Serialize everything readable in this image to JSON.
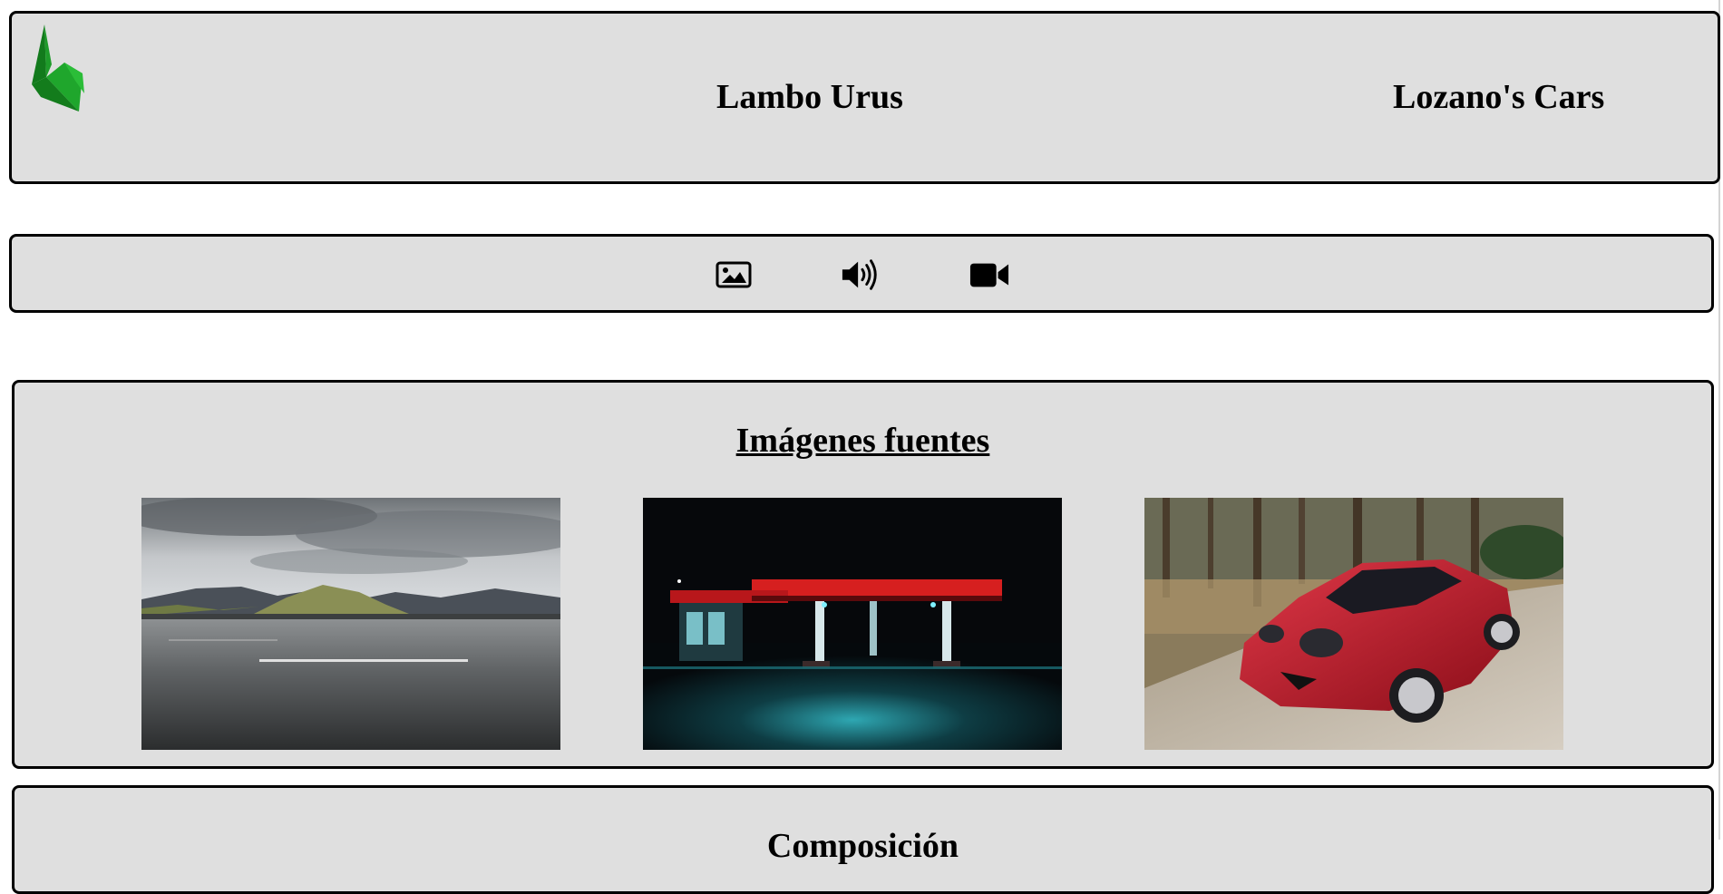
{
  "header": {
    "logo_icon": "green-k-logo-icon",
    "title": "Lambo Urus",
    "brand": "Lozano's Cars"
  },
  "toolbar": {
    "items": [
      {
        "icon": "image-icon"
      },
      {
        "icon": "volume-icon"
      },
      {
        "icon": "video-camera-icon"
      }
    ]
  },
  "sources": {
    "heading": "Imágenes fuentes",
    "images": [
      {
        "subject": "empty-road-under-cloudy-sky"
      },
      {
        "subject": "gas-station-at-night-red-lights"
      },
      {
        "subject": "red-sports-car-driving"
      }
    ]
  },
  "next_section": {
    "heading": "Composición"
  },
  "colors": {
    "panel_bg": "#dfdfdf",
    "border": "#000000",
    "logo_green": "#1e9b2a"
  }
}
